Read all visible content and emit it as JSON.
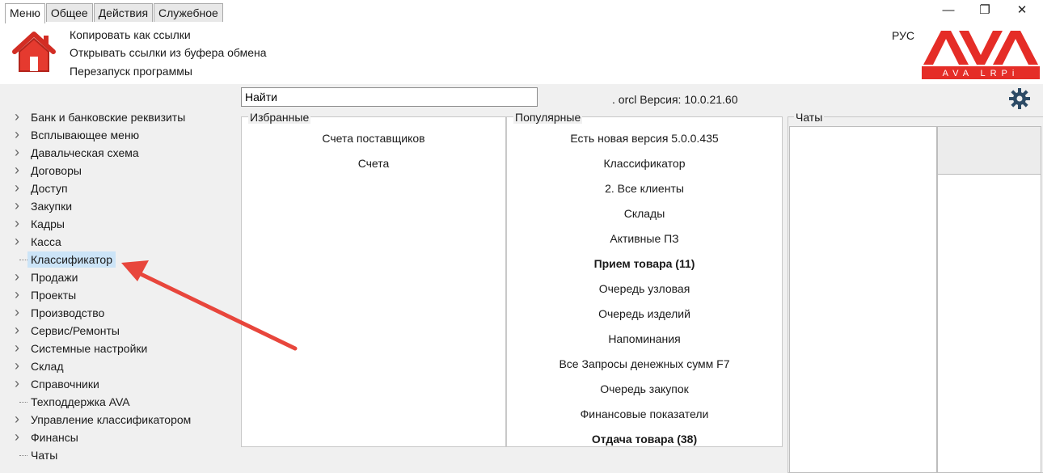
{
  "tabs": [
    "Меню",
    "Общее",
    "Действия",
    "Служебное"
  ],
  "window": {
    "minimize": "—",
    "restore": "❐",
    "close": "✕"
  },
  "commands": [
    "Копировать как ссылки",
    "Открывать ссылки из буфера обмена",
    "Перезапуск программы"
  ],
  "lang": "РУС",
  "logo": {
    "main": "AVA",
    "sub": "AVA LRPi",
    "color": "#e52d27"
  },
  "search": {
    "value": "Найти"
  },
  "version": ". orcl Версия: 10.0.21.60",
  "tree": [
    {
      "label": "Банк и банковские реквизиты",
      "expandable": true
    },
    {
      "label": "Всплывающее меню",
      "expandable": true
    },
    {
      "label": "Давальческая схема",
      "expandable": true
    },
    {
      "label": "Договоры",
      "expandable": true
    },
    {
      "label": "Доступ",
      "expandable": true
    },
    {
      "label": "Закупки",
      "expandable": true
    },
    {
      "label": "Кадры",
      "expandable": true
    },
    {
      "label": "Касса",
      "expandable": true
    },
    {
      "label": "Классификатор",
      "expandable": false,
      "selected": true
    },
    {
      "label": "Продажи",
      "expandable": true
    },
    {
      "label": "Проекты",
      "expandable": true
    },
    {
      "label": "Производство",
      "expandable": true
    },
    {
      "label": "Сервис/Ремонты",
      "expandable": true
    },
    {
      "label": "Системные настройки",
      "expandable": true
    },
    {
      "label": "Склад",
      "expandable": true
    },
    {
      "label": "Справочники",
      "expandable": true
    },
    {
      "label": "Техподдержка AVA",
      "expandable": false
    },
    {
      "label": "Управление классификатором",
      "expandable": true
    },
    {
      "label": "Финансы",
      "expandable": true
    },
    {
      "label": "Чаты",
      "expandable": false
    }
  ],
  "favorites": {
    "title": "Избранные",
    "items": [
      "Счета поставщиков",
      "Счета"
    ]
  },
  "popular": {
    "title": "Популярные",
    "items": [
      {
        "label": "Есть новая версия 5.0.0.435",
        "bold": false
      },
      {
        "label": "Классификатор",
        "bold": false
      },
      {
        "label": "2. Все клиенты",
        "bold": false
      },
      {
        "label": "Склады",
        "bold": false
      },
      {
        "label": "Активные ПЗ",
        "bold": false
      },
      {
        "label": "Прием товара (11)",
        "bold": true
      },
      {
        "label": "Очередь узловая",
        "bold": false
      },
      {
        "label": "Очередь изделий",
        "bold": false
      },
      {
        "label": "Напоминания",
        "bold": false
      },
      {
        "label": "Все Запросы денежных сумм F7",
        "bold": false
      },
      {
        "label": "Очередь закупок",
        "bold": false
      },
      {
        "label": "Финансовые показатели",
        "bold": false
      },
      {
        "label": "Отдача товара (38)",
        "bold": true
      }
    ]
  },
  "chats": {
    "title": "Чаты"
  },
  "annotation": {
    "type": "arrow",
    "color": "#e8463c"
  }
}
